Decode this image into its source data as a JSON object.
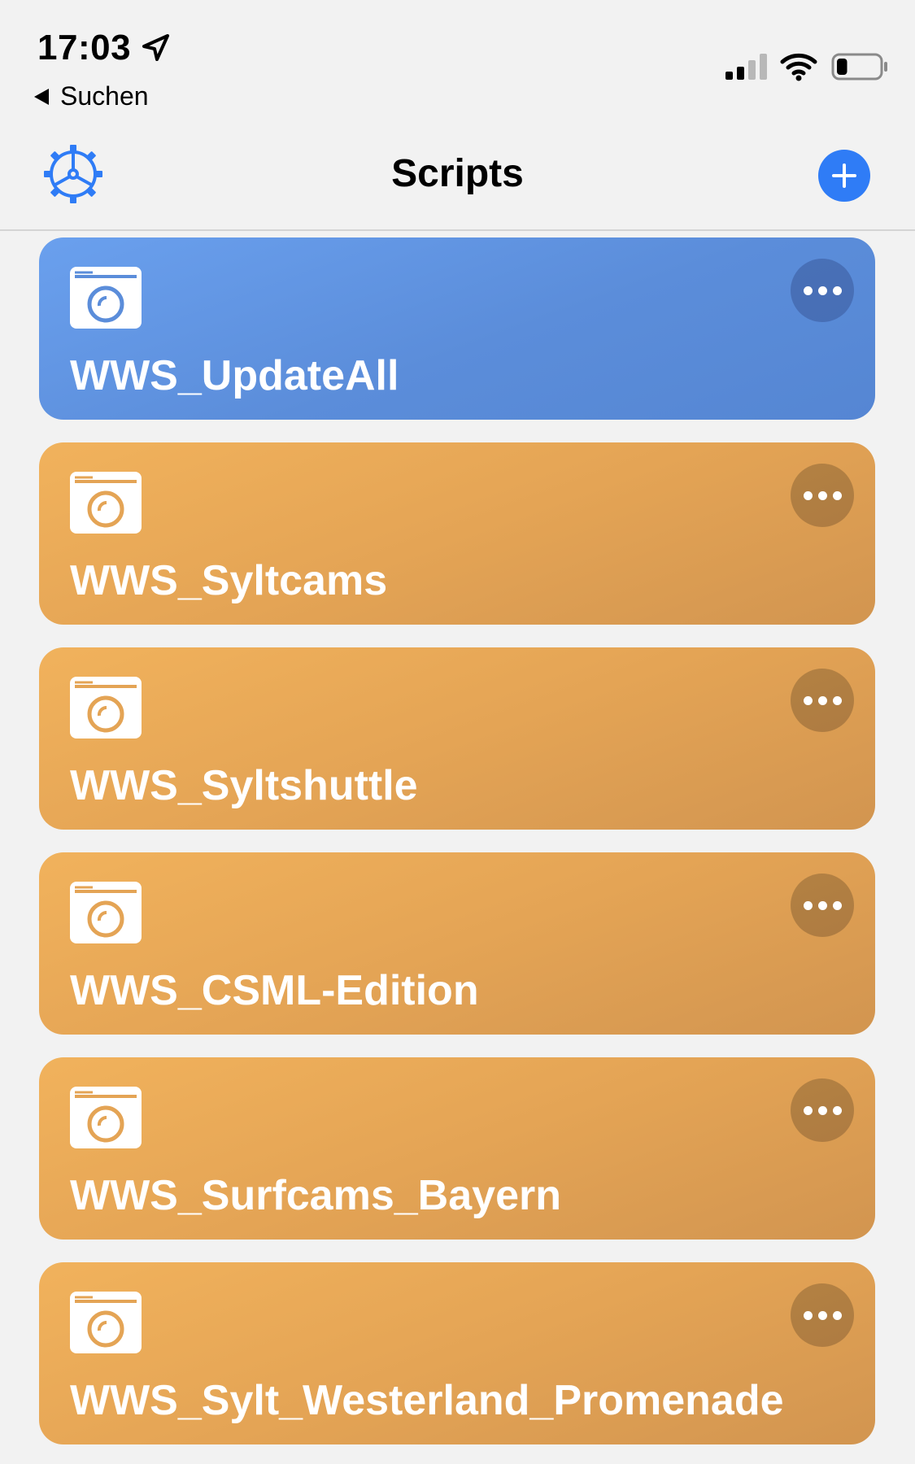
{
  "status_bar": {
    "time": "17:03",
    "back_label": "Suchen",
    "location_icon": "location-arrow-icon",
    "signal_icon": "cellular-signal-icon",
    "wifi_icon": "wifi-icon",
    "battery_icon": "battery-icon",
    "battery_level": 0.25
  },
  "nav": {
    "title": "Scripts",
    "settings_icon": "gear-icon",
    "add_icon": "plus-icon",
    "accent_color": "#2f7cf6"
  },
  "scripts": [
    {
      "title": "WWS_UpdateAll",
      "color": "blue",
      "icon": "camera-icon"
    },
    {
      "title": "WWS_Syltcams",
      "color": "orange",
      "icon": "camera-icon"
    },
    {
      "title": "WWS_Syltshuttle",
      "color": "orange",
      "icon": "camera-icon"
    },
    {
      "title": "WWS_CSML-Edition",
      "color": "orange",
      "icon": "camera-icon"
    },
    {
      "title": "WWS_Surfcams_Bayern",
      "color": "orange",
      "icon": "camera-icon"
    },
    {
      "title": "WWS_Sylt_Westerland_Promenade",
      "color": "orange",
      "icon": "camera-icon"
    }
  ],
  "colors": {
    "blue_card": "#5b8dda",
    "orange_card": "#e4a455"
  }
}
